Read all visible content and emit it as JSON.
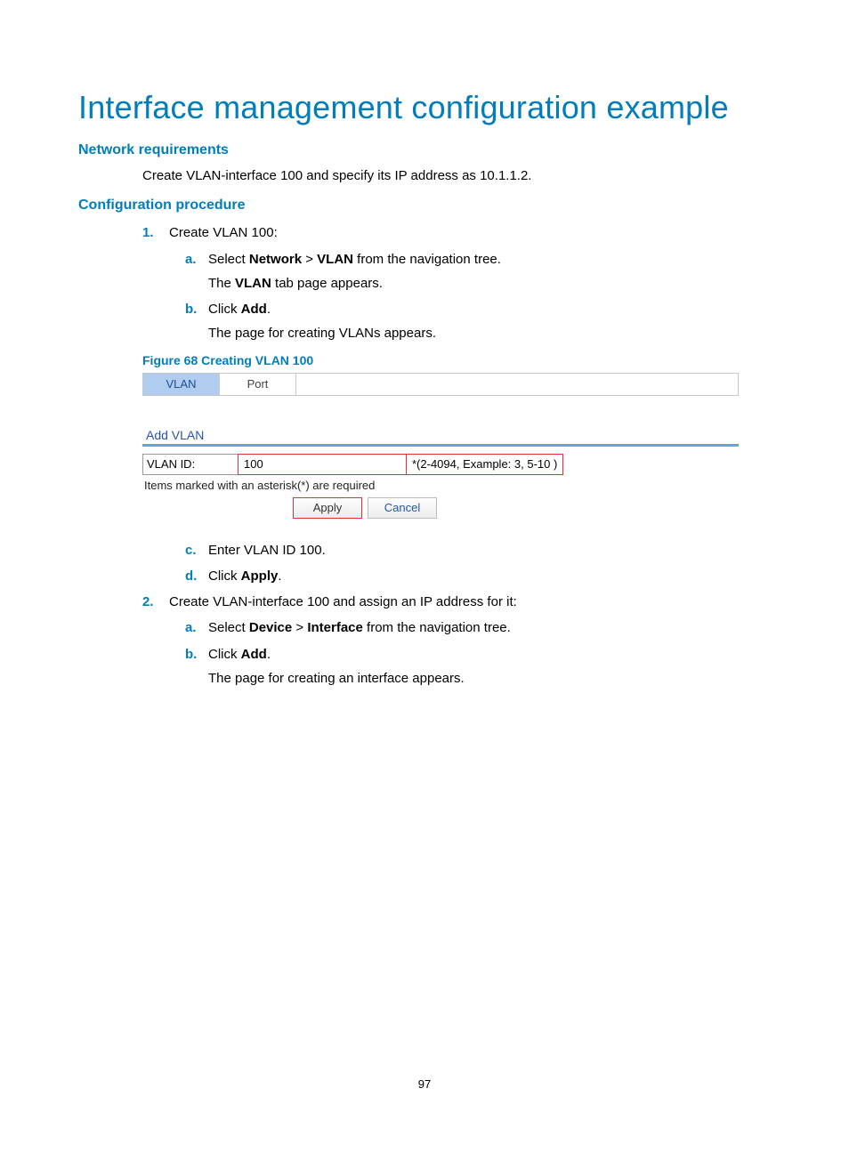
{
  "title": "Interface management configuration example",
  "sections": {
    "req_heading": "Network requirements",
    "req_text": "Create VLAN-interface 100 and specify its IP address as 10.1.1.2.",
    "proc_heading": "Configuration procedure"
  },
  "steps": {
    "s1": {
      "num": "1.",
      "text": "Create VLAN 100:",
      "a": {
        "num": "a.",
        "pre": "Select ",
        "b1": "Network",
        "mid": " > ",
        "b2": "VLAN",
        "post": " from the navigation tree.",
        "note_pre": "The ",
        "note_b": "VLAN",
        "note_post": " tab page appears."
      },
      "b": {
        "num": "b.",
        "pre": "Click ",
        "b1": "Add",
        "post": ".",
        "note": "The page for creating VLANs appears."
      },
      "c": {
        "num": "c.",
        "text": "Enter VLAN ID 100."
      },
      "d": {
        "num": "d.",
        "pre": "Click ",
        "b1": "Apply",
        "post": "."
      }
    },
    "s2": {
      "num": "2.",
      "text": "Create VLAN-interface 100 and assign an IP address for it:",
      "a": {
        "num": "a.",
        "pre": "Select ",
        "b1": "Device",
        "mid": " > ",
        "b2": "Interface",
        "post": " from the navigation tree."
      },
      "b": {
        "num": "b.",
        "pre": "Click ",
        "b1": "Add",
        "post": ".",
        "note": "The page for creating an interface appears."
      }
    }
  },
  "figure": {
    "caption": "Figure 68 Creating VLAN 100",
    "tabs": {
      "active": "VLAN",
      "inactive": "Port"
    },
    "panel_title": "Add VLAN",
    "field_label": "VLAN ID:",
    "field_value": "100",
    "field_hint": "*(2-4094, Example: 3, 5-10 )",
    "required_note": "Items marked with an asterisk(*) are required",
    "apply": "Apply",
    "cancel": "Cancel"
  },
  "page_number": "97"
}
